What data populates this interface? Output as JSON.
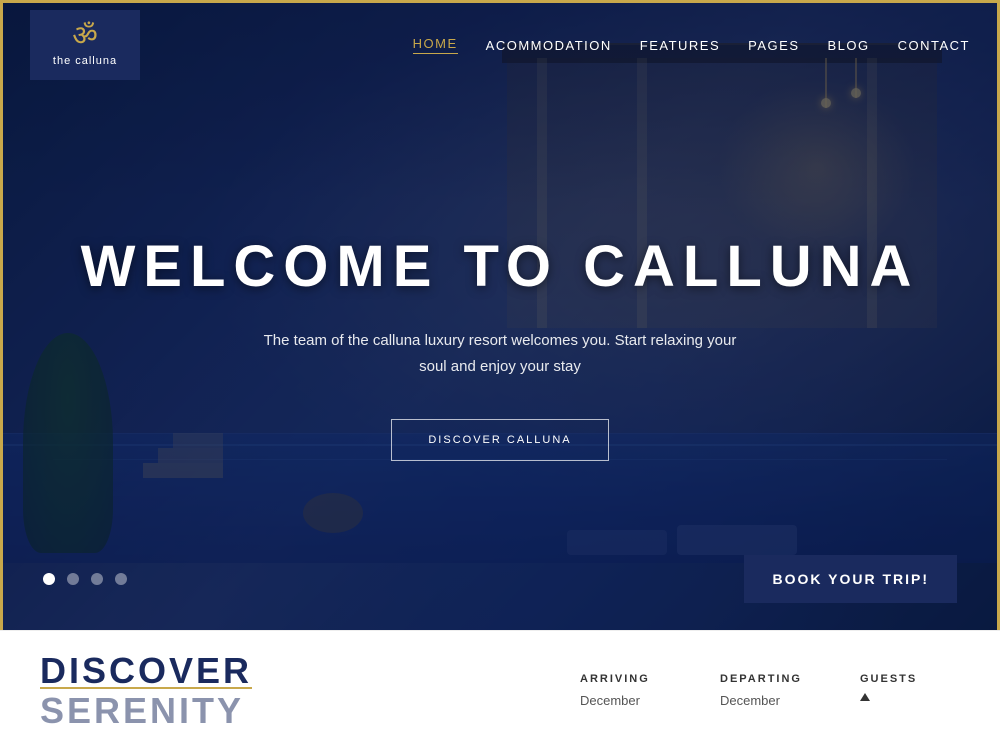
{
  "site": {
    "name": "the calluna",
    "symbol": "ॐ",
    "border_color": "#c8a84b"
  },
  "nav": {
    "items": [
      {
        "label": "HOME",
        "active": true
      },
      {
        "label": "ACOMMODATION",
        "active": false
      },
      {
        "label": "FEATURES",
        "active": false
      },
      {
        "label": "PAGES",
        "active": false
      },
      {
        "label": "BLOG",
        "active": false
      },
      {
        "label": "CONTACT",
        "active": false
      }
    ]
  },
  "hero": {
    "title": "WELCOME TO CALLUNA",
    "subtitle": "The team of the calluna luxury resort welcomes you. Start relaxing your soul and enjoy your stay",
    "cta_button": "DISCOVER CALLUNA",
    "book_button": "BOOK YOUR TRIP!"
  },
  "slider": {
    "total_dots": 4,
    "active_dot": 0
  },
  "booking": {
    "discover_line1": "DISCOVER",
    "discover_line2": "SERENITY",
    "fields": [
      {
        "label": "ARRIVING",
        "value": "December"
      },
      {
        "label": "DEPARTING",
        "value": "December"
      },
      {
        "label": "GUESTS",
        "value": "▲"
      }
    ]
  }
}
